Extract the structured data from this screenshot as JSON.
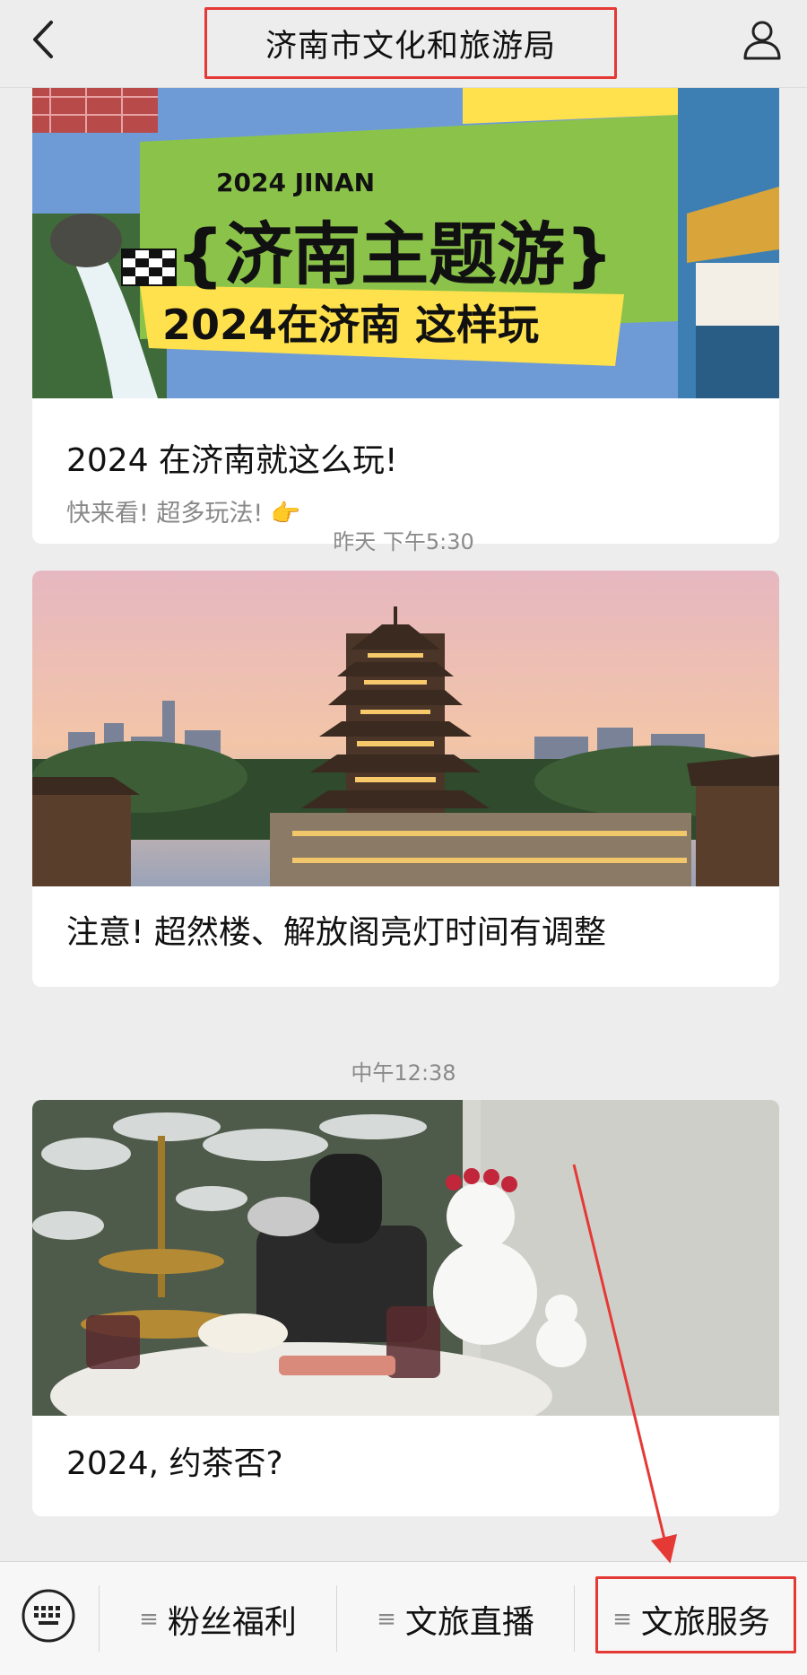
{
  "header": {
    "back_icon": "chevron-left-icon",
    "title": "济南市文化和旅游局",
    "profile_icon": "user-icon"
  },
  "banner": {
    "small_caption": "2024 JINAN",
    "big_caption": "{济南主题游}",
    "sub_caption": "2024在济南 这样玩"
  },
  "feed": [
    {
      "title": "2024 在济南就这么玩!",
      "subtitle": "快来看! 超多玩法! 👉"
    },
    {
      "time": "昨天 下午5:30",
      "title": "注意! 超然楼、解放阁亮灯时间有调整"
    },
    {
      "time": "中午12:38",
      "title": "2024, 约茶否?"
    }
  ],
  "bottom_menu": {
    "keyboard_icon": "keyboard-icon",
    "items": [
      {
        "label": "粉丝福利",
        "icon": "menu-lines-icon"
      },
      {
        "label": "文旅直播",
        "icon": "menu-lines-icon"
      },
      {
        "label": "文旅服务",
        "icon": "menu-lines-icon"
      }
    ]
  },
  "colors": {
    "background": "#ededed",
    "highlight": "#e53935",
    "banner_green": "#8bc34a",
    "banner_blue": "#6e9bd6"
  }
}
